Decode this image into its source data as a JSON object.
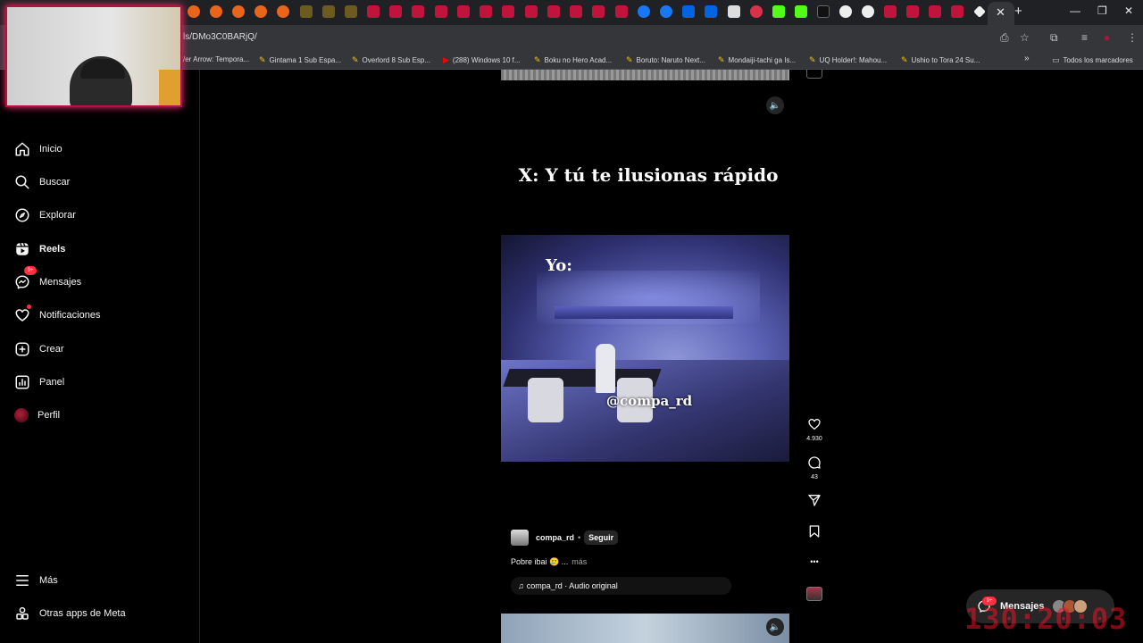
{
  "browser": {
    "url": "ls/DMo3C0BARjQ/",
    "tab_close_glyph": "✕",
    "new_tab_glyph": "+",
    "window_controls": [
      "—",
      "❐",
      "✕"
    ],
    "bookmarks": [
      {
        "label": "/er Arrow: Tempora...",
        "icon": "pen-icon"
      },
      {
        "label": "Gintama 1 Sub Espa...",
        "icon": "pen-icon"
      },
      {
        "label": "Overlord 8 Sub Esp...",
        "icon": "pen-icon"
      },
      {
        "label": "(288) Windows 10 f...",
        "icon": "youtube-icon"
      },
      {
        "label": "Boku no Hero Acad...",
        "icon": "pen-icon"
      },
      {
        "label": "Boruto: Naruto Next...",
        "icon": "pen-icon"
      },
      {
        "label": "Mondaiji-tachi ga Is...",
        "icon": "pen-icon"
      },
      {
        "label": "UQ Holder!: Mahou...",
        "icon": "pen-icon"
      },
      {
        "label": "Ushio to Tora 24 Su...",
        "icon": "pen-icon"
      }
    ],
    "bookmarks_overflow": "»",
    "all_bookmarks": "Todos los marcadores"
  },
  "sidebar": {
    "items": [
      {
        "label": "Inicio",
        "icon": "home-icon"
      },
      {
        "label": "Buscar",
        "icon": "search-icon"
      },
      {
        "label": "Explorar",
        "icon": "compass-icon"
      },
      {
        "label": "Reels",
        "icon": "reels-icon"
      },
      {
        "label": "Mensajes",
        "icon": "messenger-icon",
        "badge": "9+"
      },
      {
        "label": "Notificaciones",
        "icon": "heart-icon"
      },
      {
        "label": "Crear",
        "icon": "plus-square-icon"
      },
      {
        "label": "Panel",
        "icon": "bar-chart-icon"
      },
      {
        "label": "Perfil",
        "icon": "avatar"
      }
    ],
    "more": "Más",
    "meta_apps": "Otras apps de Meta"
  },
  "post": {
    "caption_overlay": "X: Y tú te ilusionas rápido",
    "video_text_top": "Yo:",
    "video_watermark": "@compa_rd",
    "likes": "4.930",
    "comments": "43",
    "author": "compa_rd",
    "separator": "•",
    "follow": "Seguir",
    "description": "Pobre ibai 🥲 ...",
    "more": "más",
    "audio_note": "♫",
    "audio": "compa_rd · Audio original",
    "more_options": "•••"
  },
  "messages_pill": {
    "label": "Mensajes",
    "badge": "9+"
  },
  "overlay_timer": "130:20:03",
  "colors": {
    "accent": "#ff3040",
    "background": "#000000",
    "webcam_border": "#b3113f"
  }
}
